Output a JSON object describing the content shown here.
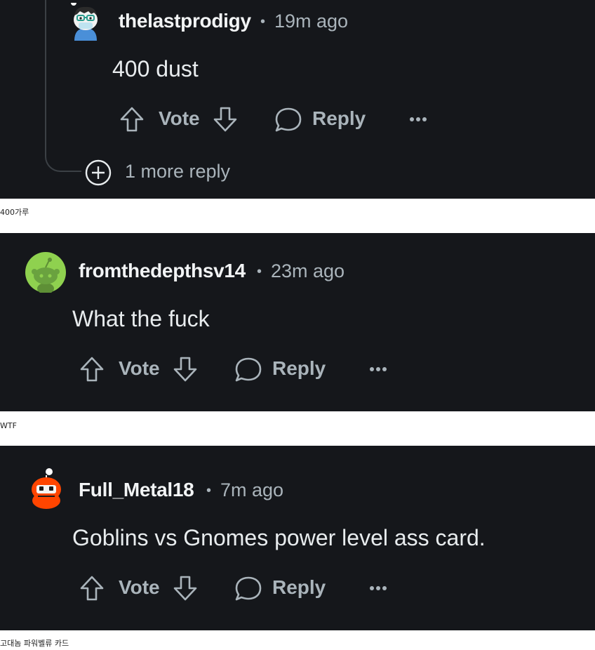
{
  "comments": [
    {
      "username": "thelastprodigy",
      "separator": "•",
      "time": "19m ago",
      "body": "400 dust",
      "vote_label": "Vote",
      "reply_label": "Reply",
      "more_replies": "1 more reply"
    },
    {
      "username": "fromthedepthsv14",
      "separator": "•",
      "time": "23m ago",
      "body": "What the fuck",
      "vote_label": "Vote",
      "reply_label": "Reply"
    },
    {
      "username": "Full_Metal18",
      "separator": "•",
      "time": "7m ago",
      "body": "Goblins vs Gnomes power level ass card.",
      "vote_label": "Vote",
      "reply_label": "Reply"
    }
  ],
  "captions": [
    "400가루",
    "WTF",
    "고대놈 파워벨류 카드"
  ],
  "colors": {
    "panel_bg": "#15171b",
    "text_primary": "#f2f4f5",
    "text_secondary": "#aab4bb",
    "avatar_green": "#8fd14f",
    "avatar_orange": "#ff4500"
  },
  "icons": [
    "upvote-icon",
    "downvote-icon",
    "reply-bubble-icon",
    "more-options-icon",
    "expand-plus-icon"
  ]
}
